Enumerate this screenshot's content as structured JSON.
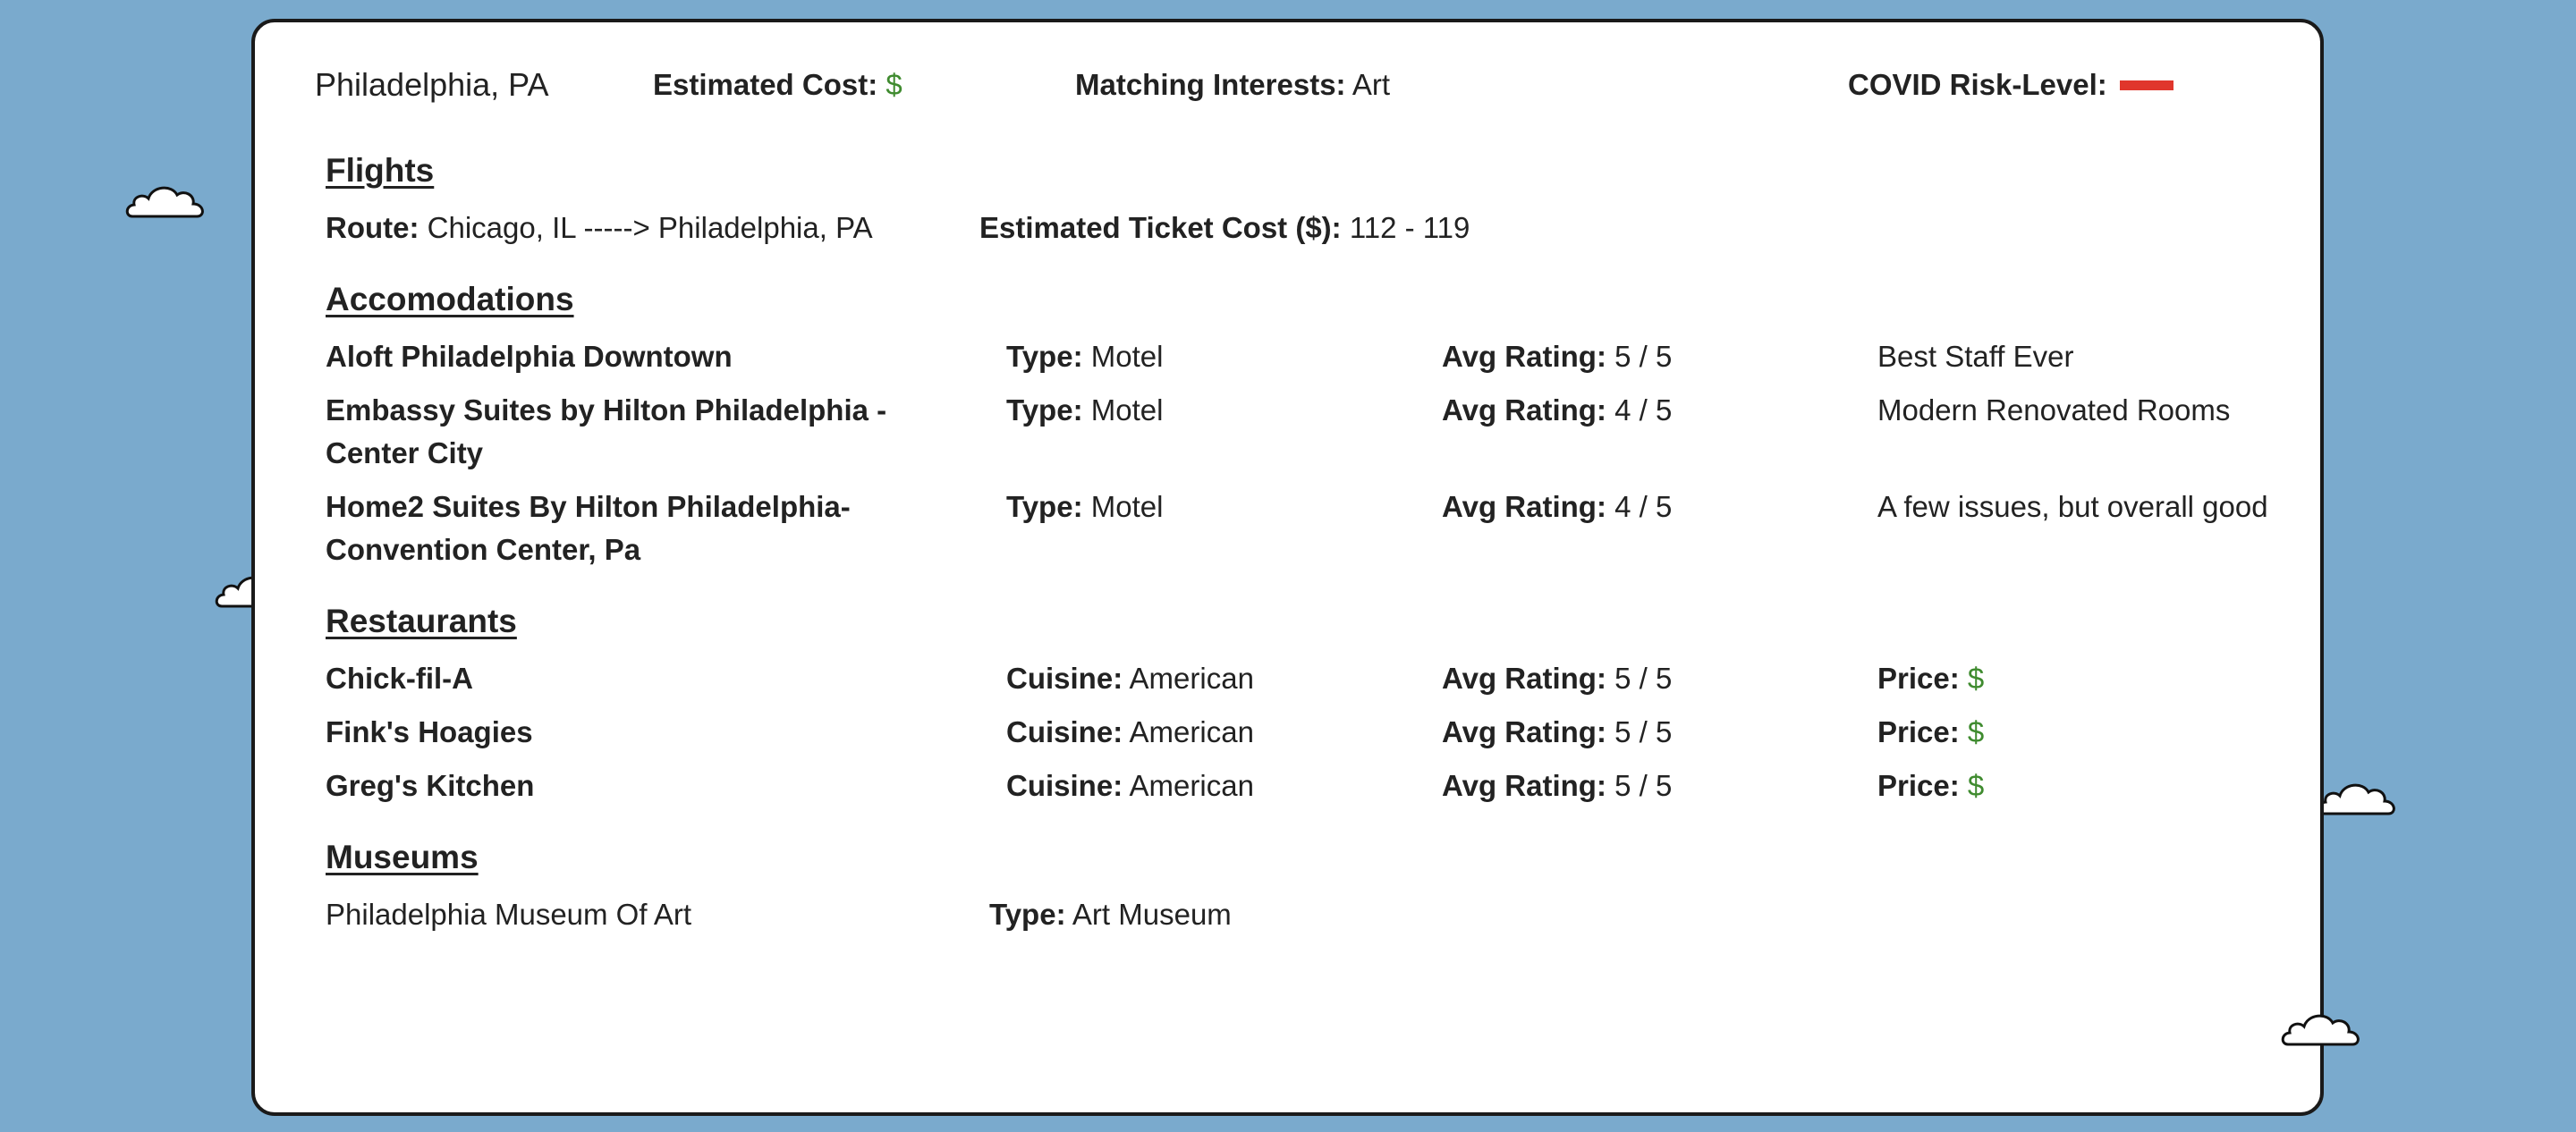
{
  "colors": {
    "background": "#7aaacd",
    "price_green": "#3f8b2f",
    "risk_red": "#e0362c"
  },
  "header": {
    "city": "Philadelphia, PA",
    "estimated_cost_label": "Estimated Cost:",
    "estimated_cost_value": "$",
    "matching_interests_label": "Matching Interests:",
    "matching_interests_value": "Art",
    "covid_label": "COVID Risk-Level:",
    "covid_level_color": "#e0362c"
  },
  "flights": {
    "title": "Flights",
    "route_label": "Route:",
    "route_value": "Chicago, IL -----> Philadelphia, PA",
    "ticket_label": "Estimated Ticket Cost ($):",
    "ticket_value": "112 - 119"
  },
  "accommodations": {
    "title": "Accomodations",
    "type_label": "Type:",
    "rating_label": "Avg Rating:",
    "items": [
      {
        "name": "Aloft Philadelphia Downtown",
        "type": "Motel",
        "rating": "5 / 5",
        "review": "Best Staff Ever"
      },
      {
        "name": "Embassy Suites by Hilton Philadelphia - Center City",
        "type": "Motel",
        "rating": "4 / 5",
        "review": "Modern Renovated Rooms"
      },
      {
        "name": "Home2 Suites By Hilton Philadelphia-Convention Center, Pa",
        "type": "Motel",
        "rating": "4 / 5",
        "review": "A few issues, but overall good"
      }
    ]
  },
  "restaurants": {
    "title": "Restaurants",
    "cuisine_label": "Cuisine:",
    "rating_label": "Avg Rating:",
    "price_label": "Price:",
    "items": [
      {
        "name": "Chick-fil-A",
        "cuisine": "American",
        "rating": "5 / 5",
        "price": "$"
      },
      {
        "name": "Fink's Hoagies",
        "cuisine": "American",
        "rating": "5 / 5",
        "price": "$"
      },
      {
        "name": "Greg's Kitchen",
        "cuisine": "American",
        "rating": "5 / 5",
        "price": "$"
      }
    ]
  },
  "museums": {
    "title": "Museums",
    "type_label": "Type:",
    "items": [
      {
        "name": "Philadelphia Museum Of Art",
        "type": "Art Museum"
      }
    ]
  },
  "icons": {
    "cloud": "cloud-icon"
  }
}
